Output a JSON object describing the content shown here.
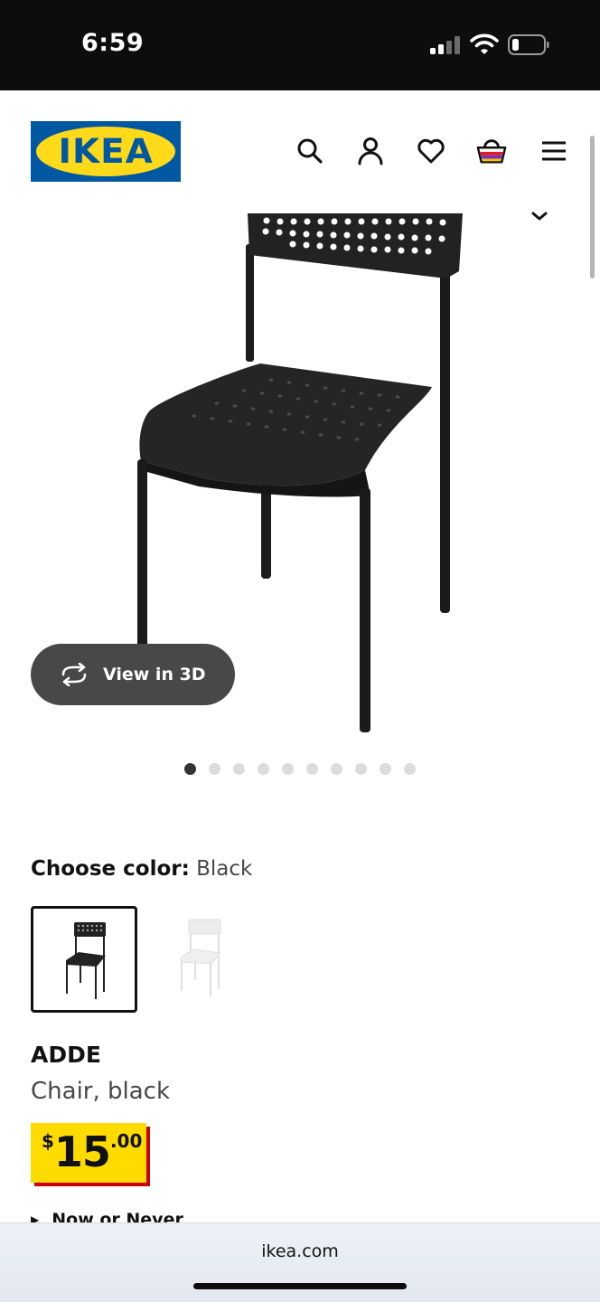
{
  "status": {
    "time": "6:59",
    "icons": [
      "signal-icon",
      "wifi-icon",
      "battery-icon"
    ]
  },
  "header": {
    "logo": "IKEA",
    "icons": [
      "search-icon",
      "account-icon",
      "heart-icon",
      "basket-icon",
      "menu-icon"
    ],
    "brand_blue": "#0058a3",
    "brand_yellow": "#ffda1a"
  },
  "gallery": {
    "view3d_label": "View in 3D",
    "total_images": 10,
    "active_index": 0
  },
  "color_chooser": {
    "label": "Choose color:",
    "selected": "Black",
    "options": [
      "Black",
      "White"
    ]
  },
  "product": {
    "name": "ADDE",
    "description": "Chair, black",
    "price": {
      "currency": "$",
      "integer": "15",
      "decimal": ".00"
    },
    "price_bg": "#ffdb00",
    "price_shadow": "#cc0008",
    "promo": "Now or Never"
  },
  "browser": {
    "url": "ikea.com"
  }
}
